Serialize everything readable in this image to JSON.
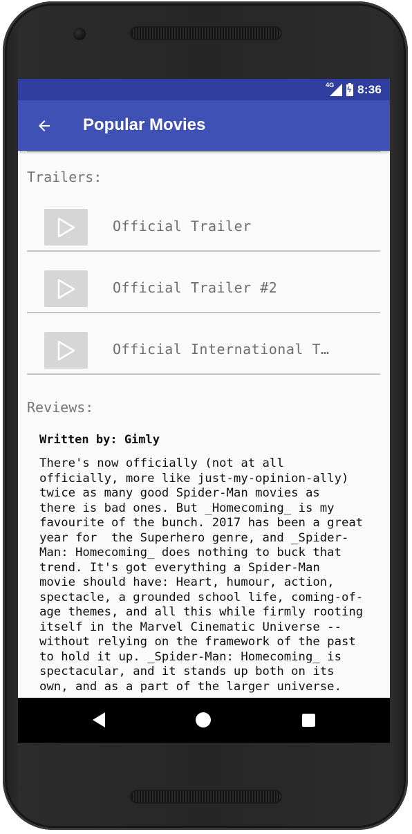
{
  "status_bar": {
    "network": "4G",
    "time": "8:36"
  },
  "app_bar": {
    "title": "Popular Movies",
    "back_icon": "arrow-back-icon"
  },
  "trailers": {
    "heading": "Trailers:",
    "items": [
      {
        "label": "Official Trailer",
        "icon": "play-icon"
      },
      {
        "label": "Official Trailer #2",
        "icon": "play-icon"
      },
      {
        "label": "Official International T…",
        "icon": "play-icon"
      }
    ]
  },
  "reviews": {
    "heading": "Reviews:",
    "items": [
      {
        "author_line": "Written by: Gimly",
        "text": "There's now officially (not at all\nofficially, more like just-my-opinion-ally)\ntwice as many good Spider-Man movies as\nthere is bad ones. But _Homecoming_ is my\nfavourite of the bunch. 2017 has been a great\nyear for  the Superhero genre, and _Spider-\nMan: Homecoming_ does nothing to buck that\ntrend. It's got everything a Spider-Man\nmovie should have: Heart, humour, action,\nspectacle, a grounded school life, coming-of-\nage themes, and all this while firmly rooting\nitself in the Marvel Cinematic Universe --\nwithout relying on the framework of the past\nto hold it up. _Spider-Man: Homecoming_ is\nspectacular, and it stands up both on its\nown, and as a part of the larger universe."
      }
    ]
  },
  "nav_bar": {
    "back_icon": "nav-back-icon",
    "home_icon": "nav-home-icon",
    "recents_icon": "nav-recents-icon"
  },
  "colors": {
    "status_bar": "#303f9f",
    "app_bar": "#3f51b5",
    "background": "#fafafa",
    "thumbnail": "#d6d6d6",
    "secondary_text": "#757575"
  }
}
